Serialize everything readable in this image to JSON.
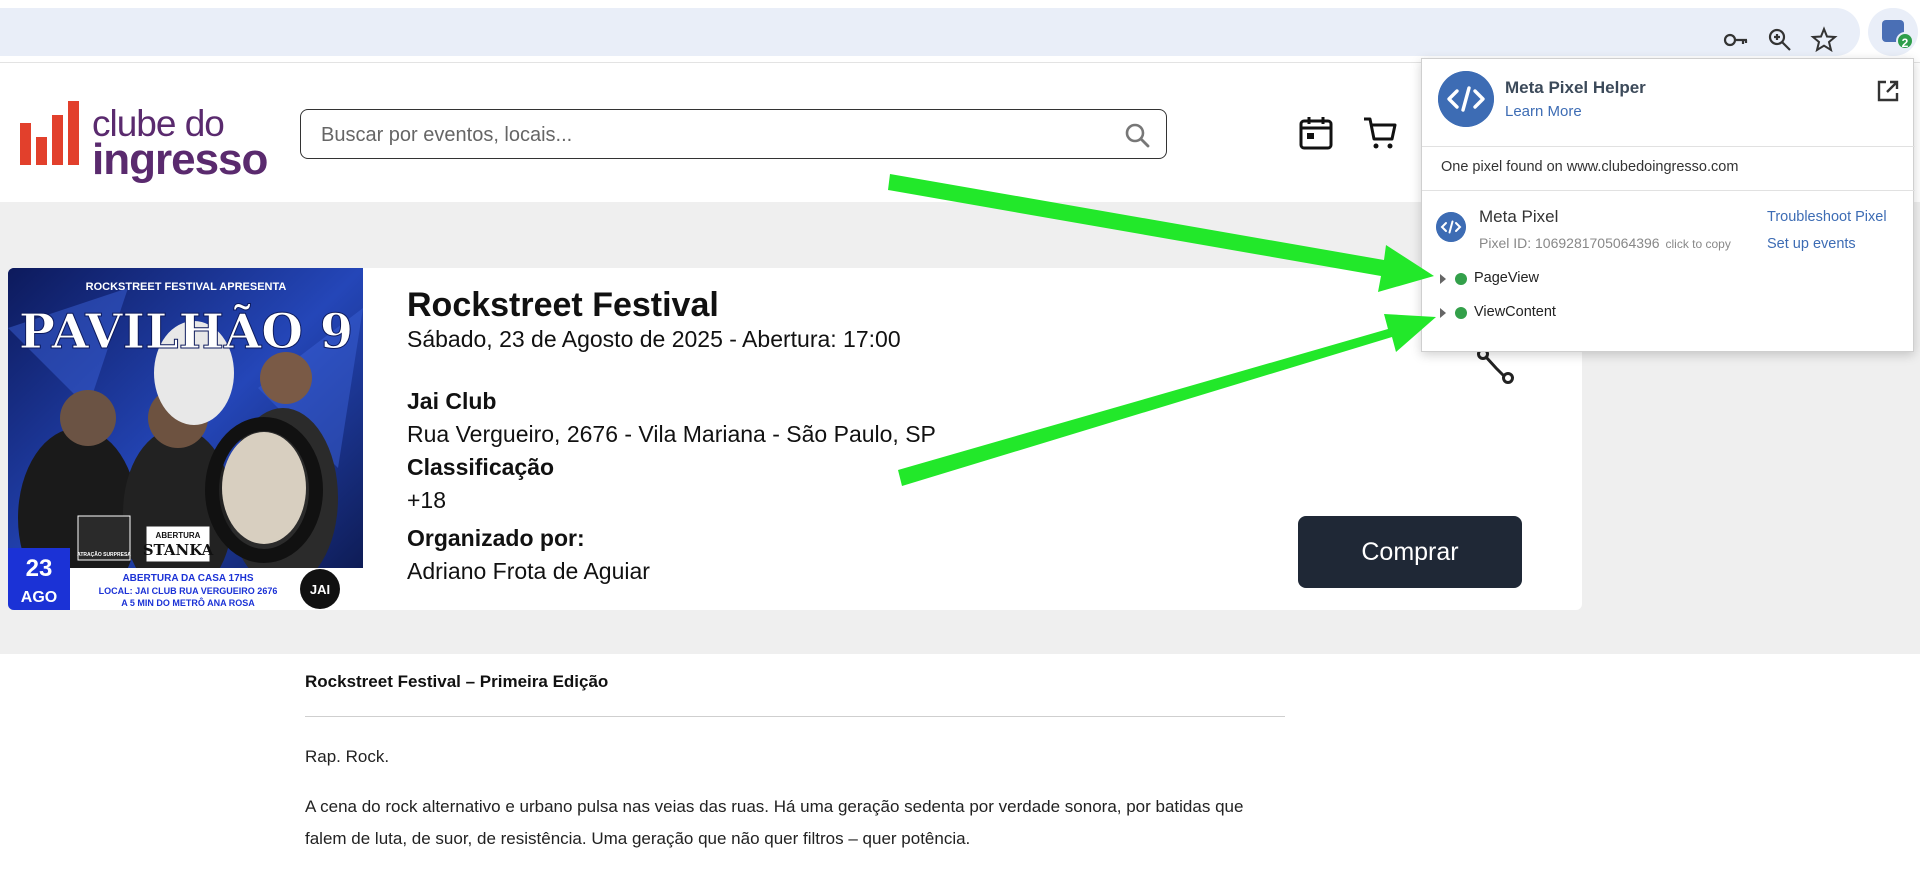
{
  "colors": {
    "brand_orange": "#e2402c",
    "brand_purple": "#5a2a6e",
    "buy_button": "#1f2836",
    "pixel_blue": "#3d6cb4",
    "status_green": "#33a04a",
    "arrow_green": "#22e82a"
  },
  "browser": {
    "icons": [
      "key-icon",
      "zoom-icon",
      "star-icon"
    ],
    "extension_badge": "2"
  },
  "site": {
    "logo_line1": "clube do",
    "logo_line2": "ingresso",
    "search_placeholder": "Buscar por eventos, locais...",
    "header_icons": [
      "calendar-icon",
      "cart-icon"
    ]
  },
  "event": {
    "title": "Rockstreet Festival",
    "date": "Sábado, 23 de Agosto de 2025 - Abertura: 17:00",
    "venue_name": "Jai Club",
    "venue_address": "Rua Vergueiro, 2676 - Vila Mariana - São Paulo, SP",
    "rating_label": "Classificação",
    "rating_value": "+18",
    "organizer_label": "Organizado por:",
    "organizer_value": "Adriano Frota de Aguiar",
    "buy_label": "Comprar"
  },
  "poster": {
    "header": "ROCKSTREET FESTIVAL APRESENTA",
    "title": "PAVILHÃO 9",
    "day": "23",
    "month": "AGO",
    "line1": "ABERTURA DA CASA 17HS",
    "line2": "LOCAL: JAI CLUB RUA VERGUEIRO 2676",
    "line3": "A 5 MIN DO METRÔ ANA ROSA",
    "surprise": "ATRAÇÃO SURPRESA",
    "opening": "ABERTURA",
    "opening_act": "STANKA",
    "logo_text": "JAI"
  },
  "description": {
    "title": "Rockstreet Festival – Primeira Edição",
    "p1": "Rap. Rock.",
    "p2": "A cena do rock alternativo e urbano pulsa nas veias das ruas. Há uma geração sedenta por verdade sonora, por batidas que falem de luta, de suor, de resistência. Uma geração que não quer filtros – quer potência."
  },
  "pixel_helper": {
    "title": "Meta Pixel Helper",
    "learn_more": "Learn More",
    "found_text": "One pixel found on www.clubedoingresso.com",
    "pixel_name": "Meta Pixel",
    "pixel_id": "Pixel ID: 1069281705064396",
    "copy_hint": "click to copy",
    "troubleshoot": "Troubleshoot Pixel",
    "setup_events": "Set up events",
    "events": [
      "PageView",
      "ViewContent"
    ]
  }
}
